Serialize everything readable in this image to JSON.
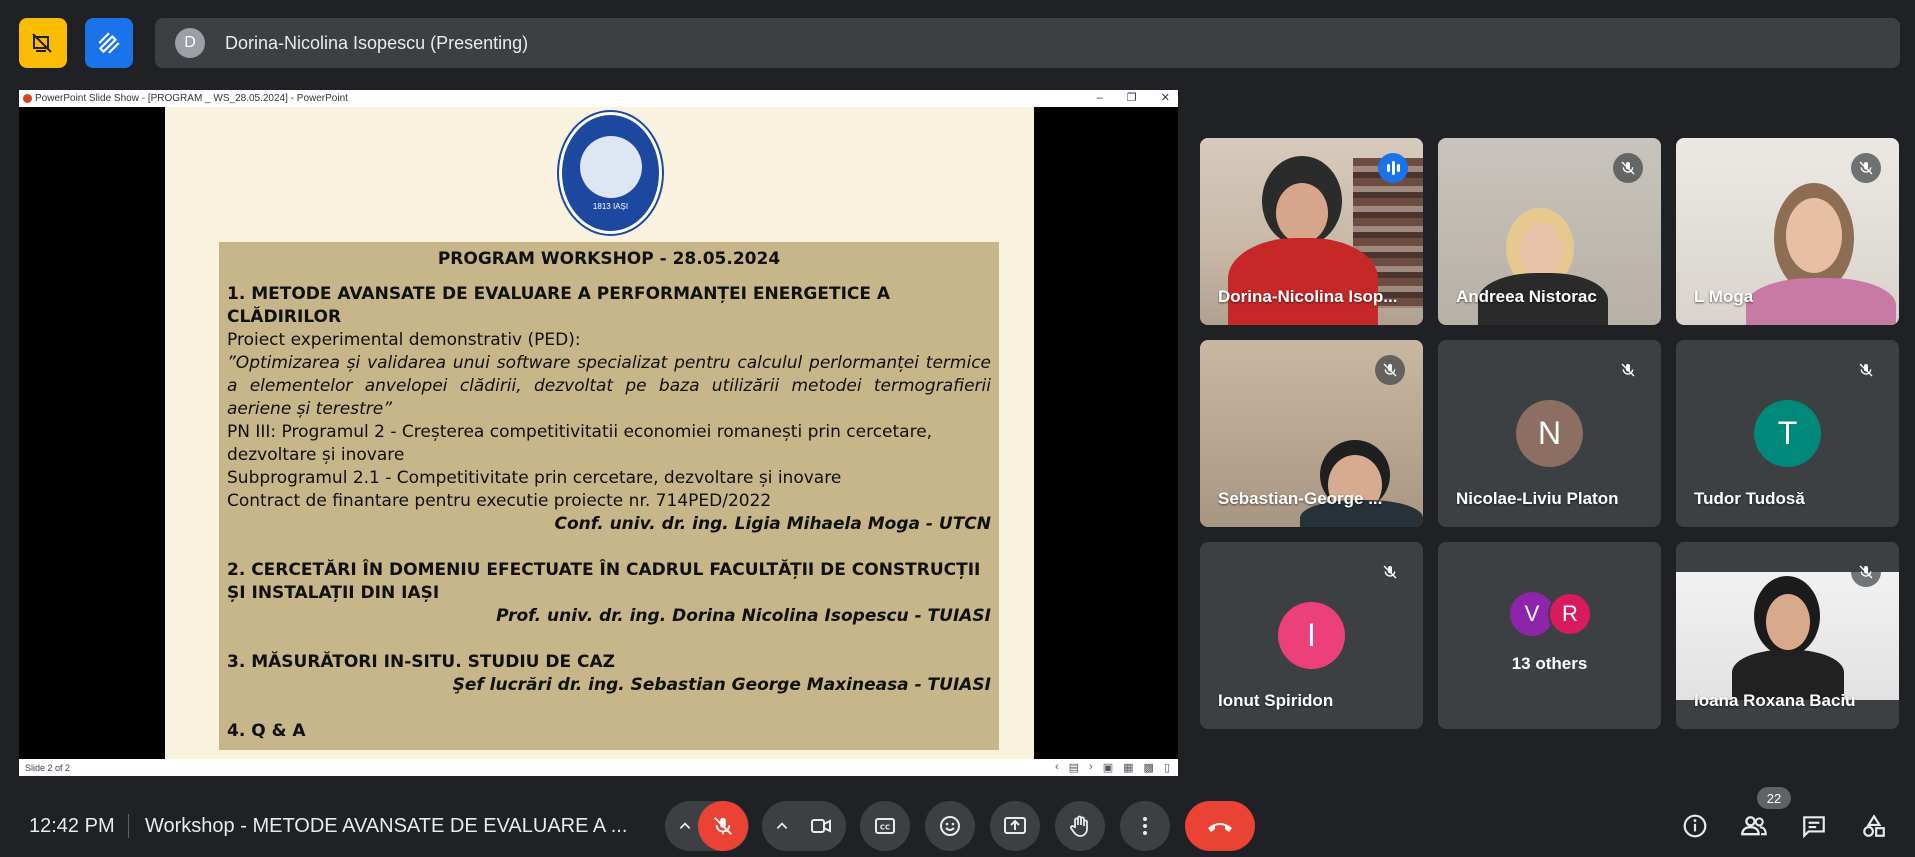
{
  "topbar": {
    "presenter_initial": "D",
    "presenter_label": "Dorina-Nicolina Isopescu (Presenting)"
  },
  "presentation": {
    "window_title": "PowerPoint Slide Show - [PROGRAM _ WS_28.05.2024] - PowerPoint",
    "status": "Slide 2 of 2",
    "seal_year": "1813 IAȘI",
    "slide": {
      "title": "PROGRAM WORKSHOP - 28.05.2024",
      "item1_heading": "1. METODE AVANSATE DE EVALUARE A PERFORMANȚEI ENERGETICE A CLĂDIRILOR",
      "item1_line1": "Proiect experimental demonstrativ (PED):",
      "item1_quote": "”Optimizarea și validarea unui software specializat pentru calculul perlormanței termice a elementelor anvelopei clădirii, dezvoltat pe baza utilizării metodei termografierii aeriene și terestre”",
      "item1_line2": "PN III: Programul 2 - Creșterea competitivitatii economiei romanești prin cercetare, dezvoltare și inovare",
      "item1_line3": "Subprogramul 2.1 - Competitivitate prin cercetare, dezvoltare și inovare",
      "item1_line4": "Contract de finantare pentru executie proiecte nr. 714PED/2022",
      "item1_author": "Conf. univ. dr. ing. Ligia Mihaela Moga - UTCN",
      "item2_heading": "2. CERCETĂRI ÎN DOMENIU EFECTUATE ÎN CADRUL FACULTĂȚII DE CONSTRUCȚII ȘI INSTALAȚII DIN IAȘI",
      "item2_author": "Prof. univ. dr. ing. Dorina Nicolina Isopescu - TUIASI",
      "item3_heading": "3. MĂSURĂTORI IN-SITU. STUDIU DE CAZ",
      "item3_author": "Şef lucrări dr. ing. Sebastian George Maxineasa - TUIASI",
      "item4_heading": "4. Q & A"
    }
  },
  "participants": [
    {
      "name": "Dorina-Nicolina Isop...",
      "speaking": true
    },
    {
      "name": "Andreea Nistorac",
      "muted": true
    },
    {
      "name": "L Moga",
      "muted": true
    },
    {
      "name": "Sebastian-George ...",
      "muted": true
    },
    {
      "name": "Nicolae-Liviu Platon",
      "initial": "N",
      "color": "#8d6e63",
      "muted": true
    },
    {
      "name": "Tudor Tudosă",
      "initial": "T",
      "color": "#00897b",
      "muted": true
    },
    {
      "name": "Ionut Spiridon",
      "initial": "I",
      "color": "#ec407a",
      "muted": true
    },
    {
      "name": "13 others",
      "initials": [
        "V",
        "R"
      ],
      "colors": [
        "#8e24aa",
        "#d81b60"
      ]
    },
    {
      "name": "Ioana Roxana Baciu",
      "muted": true
    }
  ],
  "bottombar": {
    "time": "12:42 PM",
    "meeting_title": "Workshop - METODE AVANSATE DE EVALUARE A ...",
    "people_count": "22"
  }
}
